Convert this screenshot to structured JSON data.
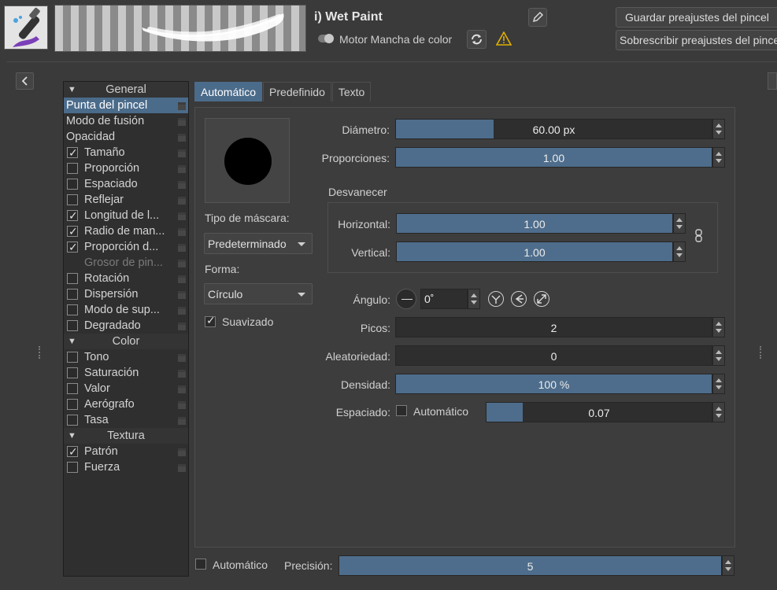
{
  "header": {
    "preset_name": "i) Wet Paint",
    "engine_label": "Motor Mancha de color",
    "save_preset_label": "Guardar preajustes del pincel",
    "overwrite_preset_label": "Sobrescribir preajustes del pincel"
  },
  "options": [
    {
      "type": "group",
      "label": "General"
    },
    {
      "type": "item",
      "label": "Punta del pincel",
      "checkbox": false,
      "selected": true
    },
    {
      "type": "item",
      "label": "Modo de fusión",
      "checkbox": false
    },
    {
      "type": "item",
      "label": "Opacidad",
      "checkbox": false
    },
    {
      "type": "item",
      "label": "Tamaño",
      "checkbox": true,
      "checked": true
    },
    {
      "type": "item",
      "label": "Proporción",
      "checkbox": true,
      "checked": false
    },
    {
      "type": "item",
      "label": "Espaciado",
      "checkbox": true,
      "checked": false
    },
    {
      "type": "item",
      "label": "Reflejar",
      "checkbox": true,
      "checked": false
    },
    {
      "type": "item",
      "label": "Longitud de l...",
      "checkbox": true,
      "checked": true
    },
    {
      "type": "item",
      "label": "Radio de man...",
      "checkbox": true,
      "checked": true
    },
    {
      "type": "item",
      "label": "Proporción d...",
      "checkbox": true,
      "checked": true
    },
    {
      "type": "item",
      "label": "Grosor de pin...",
      "checkbox": false,
      "disabled": true
    },
    {
      "type": "item",
      "label": "Rotación",
      "checkbox": true,
      "checked": false
    },
    {
      "type": "item",
      "label": "Dispersión",
      "checkbox": true,
      "checked": false
    },
    {
      "type": "item",
      "label": "Modo de sup...",
      "checkbox": true,
      "checked": false
    },
    {
      "type": "item",
      "label": "Degradado",
      "checkbox": true,
      "checked": false
    },
    {
      "type": "group",
      "label": "Color"
    },
    {
      "type": "item",
      "label": "Tono",
      "checkbox": true,
      "checked": false
    },
    {
      "type": "item",
      "label": "Saturación",
      "checkbox": true,
      "checked": false
    },
    {
      "type": "item",
      "label": "Valor",
      "checkbox": true,
      "checked": false
    },
    {
      "type": "item",
      "label": "Aerógrafo",
      "checkbox": true,
      "checked": false
    },
    {
      "type": "item",
      "label": "Tasa",
      "checkbox": true,
      "checked": false
    },
    {
      "type": "group",
      "label": "Textura"
    },
    {
      "type": "item",
      "label": "Patrón",
      "checkbox": true,
      "checked": true
    },
    {
      "type": "item",
      "label": "Fuerza",
      "checkbox": true,
      "checked": false
    }
  ],
  "tabs": [
    {
      "label": "Automático",
      "active": true
    },
    {
      "label": "Predefinido",
      "active": false
    },
    {
      "label": "Texto",
      "active": false
    }
  ],
  "tip": {
    "mask_type_label": "Tipo de máscara:",
    "mask_type_value": "Predeterminado",
    "shape_label": "Forma:",
    "shape_value": "Círculo",
    "antialias_label": "Suavizado",
    "antialias_checked": true
  },
  "params": {
    "diameter": {
      "label": "Diámetro:",
      "value": "60.00 px",
      "fill": 0.31
    },
    "ratio": {
      "label": "Proporciones:",
      "value": "1.00",
      "fill": 1.0
    },
    "fade_title": "Desvanecer",
    "horizontal": {
      "label": "Horizontal:",
      "value": "1.00",
      "fill": 1.0
    },
    "vertical": {
      "label": "Vertical:",
      "value": "1.00",
      "fill": 1.0
    },
    "angle": {
      "label": "Ángulo:",
      "value": "0˚"
    },
    "spikes": {
      "label": "Picos:",
      "value": "2",
      "fill": 0.0
    },
    "randomness": {
      "label": "Aleatoriedad:",
      "value": "0",
      "fill": 0.0
    },
    "density": {
      "label": "Densidad:",
      "value": "100 %",
      "fill": 1.0
    },
    "spacing": {
      "label": "Espaciado:",
      "auto_label": "Automático",
      "value": "0.07",
      "fill": 0.16
    }
  },
  "footer": {
    "auto_label": "Automático",
    "precision_label": "Precisión:",
    "precision_value": "5",
    "precision_fill": 1.0
  },
  "colors": {
    "accent": "#4b6b8a",
    "slider_fill": "#4e6d8c",
    "background": "#3a3a3a",
    "warning": "#e0b000"
  }
}
